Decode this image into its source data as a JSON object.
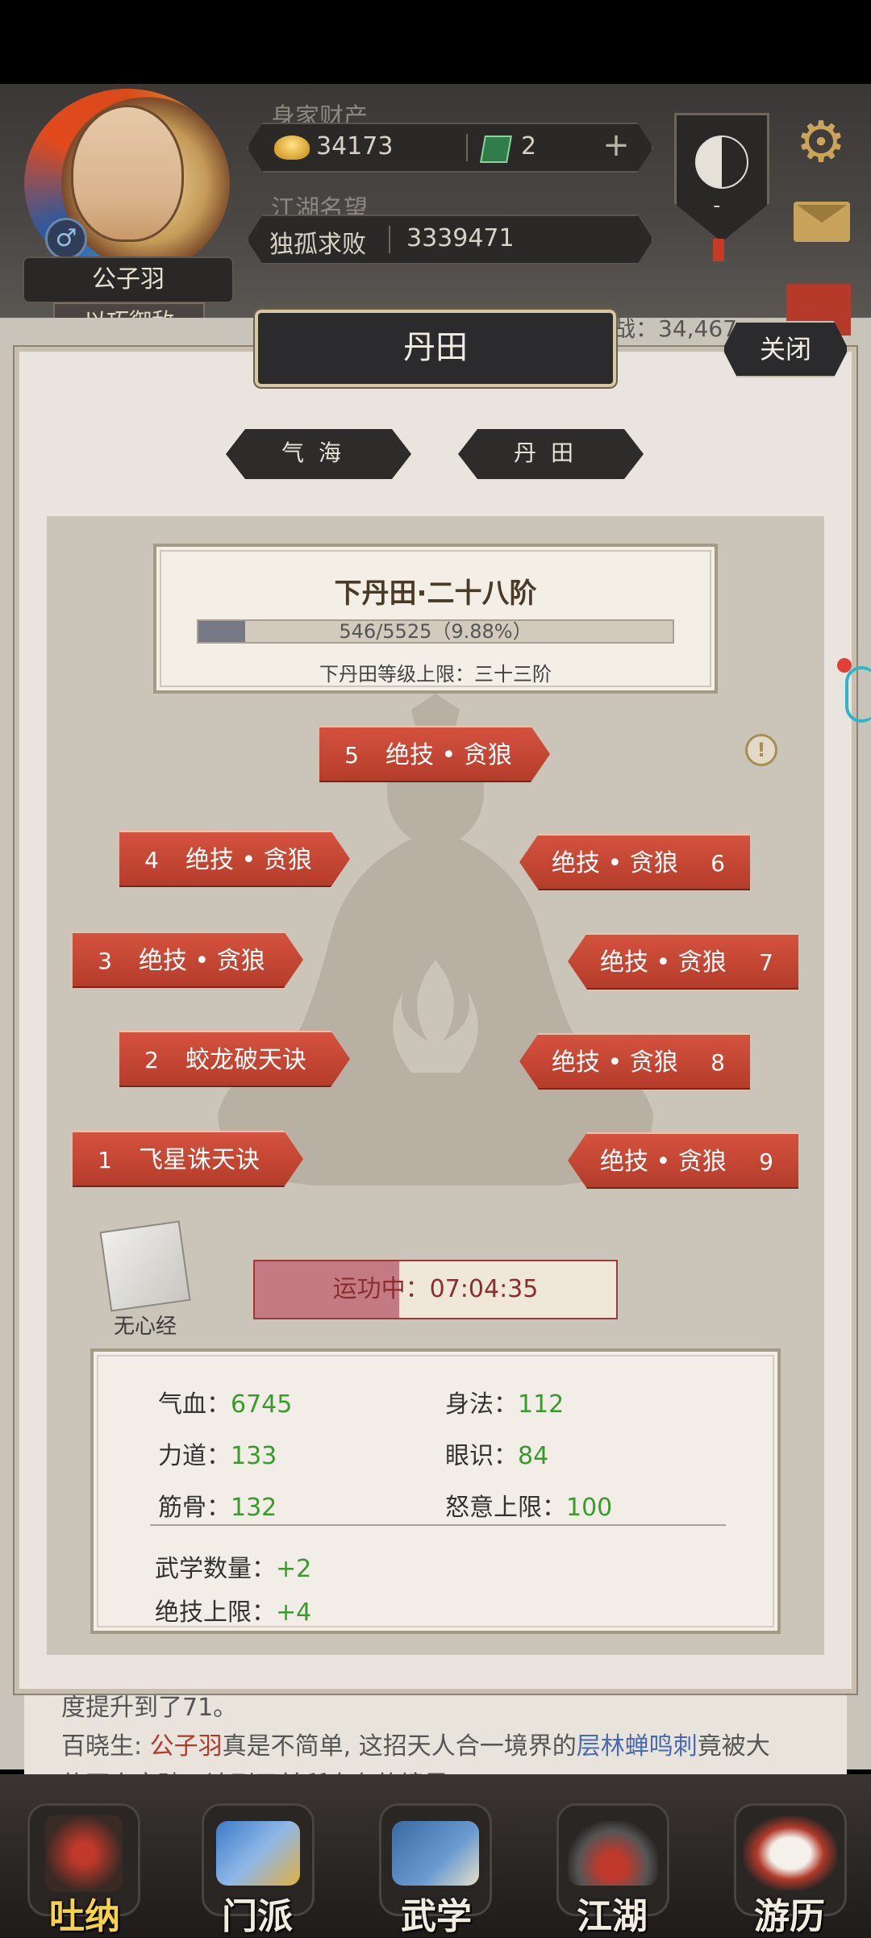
{
  "header": {
    "wealth_label": "身家财产",
    "gold": "34173",
    "jade": "2",
    "reputation_label": "江湖名望",
    "rep_title": "独孤求败",
    "rep_value": "3339471",
    "player_name": "公子羽",
    "player_title": "以巧御敌",
    "gender_symbol": "♂",
    "plus_symbol": "+",
    "taiji_mark": "-"
  },
  "background": {
    "score_text": "战：34,467",
    "log_line1": "度提升到了71。",
    "log_line2_prefix": "百晓生: ",
    "log_line2_name": "公子羽",
    "log_line2_mid": "真是不简单, 这招天人合一境界的",
    "log_line2_skill": "层林蝉鸣刺",
    "log_line2_suffix": "竟被大",
    "log_line3": "侠再次突破，达到了前所未有的境界"
  },
  "dialog": {
    "title": "丹田",
    "close_label": "关闭",
    "tabs": [
      "气海",
      "丹田"
    ],
    "level_title": "下丹田·二十八阶",
    "progress_text": "546/5525（9.88%）",
    "progress_fraction": 0.0988,
    "level_cap": "下丹田等级上限：三十三阶",
    "info_symbol": "!",
    "skills": [
      {
        "num": "1",
        "name": "飞星诛天诀"
      },
      {
        "num": "2",
        "name": "蛟龙破天诀"
      },
      {
        "num": "3",
        "name": "绝技 • 贪狼"
      },
      {
        "num": "4",
        "name": "绝技 • 贪狼"
      },
      {
        "num": "5",
        "name": "绝技 • 贪狼"
      },
      {
        "num": "6",
        "name": "绝技 • 贪狼"
      },
      {
        "num": "7",
        "name": "绝技 • 贪狼"
      },
      {
        "num": "8",
        "name": "绝技 • 贪狼"
      },
      {
        "num": "9",
        "name": "绝技 • 贪狼"
      }
    ],
    "book_label": "无心经",
    "running_text": "运功中：07:04:35",
    "running_fraction": 0.4,
    "attrs": {
      "qixue_label": "气血：",
      "qixue": "6745",
      "shenfa_label": "身法：",
      "shenfa": "112",
      "lidao_label": "力道：",
      "lidao": "133",
      "yanshi_label": "眼识：",
      "yanshi": "84",
      "jingu_label": "筋骨：",
      "jingu": "132",
      "nuyi_label": "怒意上限：",
      "nuyi": "100",
      "wuxue_label": "武学数量：",
      "wuxue": "+2",
      "jiji_label": "绝技上限：",
      "jiji": "+4"
    }
  },
  "nav": {
    "items": [
      "吐纳",
      "门派",
      "武学",
      "江湖",
      "游历"
    ],
    "active": "吐纳"
  },
  "colors": {
    "skill_red": "#c0452f",
    "value_green": "#3a9a2c",
    "active_nav": "#f8d24a"
  }
}
